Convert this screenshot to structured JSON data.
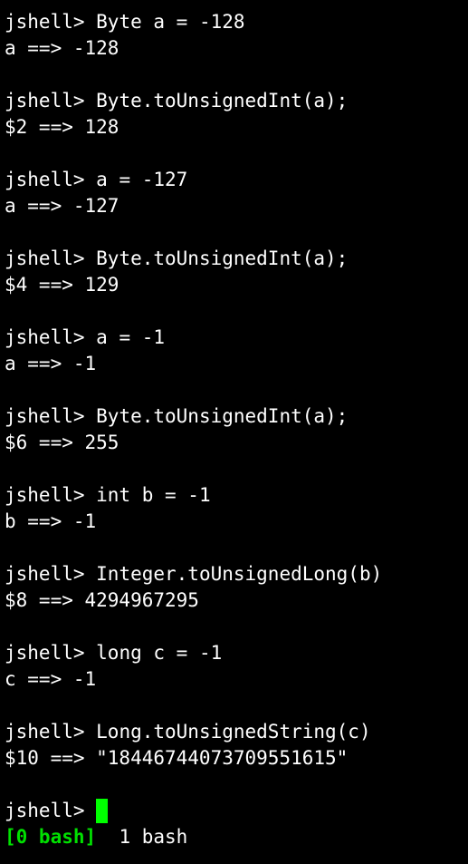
{
  "terminal": {
    "prompt": "jshell> ",
    "entries": [
      {
        "input": "Byte a = -128",
        "output": "a ==> -128"
      },
      {
        "input": "Byte.toUnsignedInt(a);",
        "output": "$2 ==> 128"
      },
      {
        "input": "a = -127",
        "output": "a ==> -127"
      },
      {
        "input": "Byte.toUnsignedInt(a);",
        "output": "$4 ==> 129"
      },
      {
        "input": "a = -1",
        "output": "a ==> -1"
      },
      {
        "input": "Byte.toUnsignedInt(a);",
        "output": "$6 ==> 255"
      },
      {
        "input": "int b = -1",
        "output": "b ==> -1"
      },
      {
        "input": "Integer.toUnsignedLong(b)",
        "output": "$8 ==> 4294967295"
      },
      {
        "input": "long c = -1",
        "output": "c ==> -1"
      },
      {
        "input": "Long.toUnsignedString(c)",
        "output": "$10 ==> \"18446744073709551615\""
      }
    ],
    "current_input": "",
    "cursor_color": "#00ff00"
  },
  "status_bar": {
    "active_window": "[0 bash]",
    "other_window": "  1 bash",
    "active_color": "#00e000"
  }
}
